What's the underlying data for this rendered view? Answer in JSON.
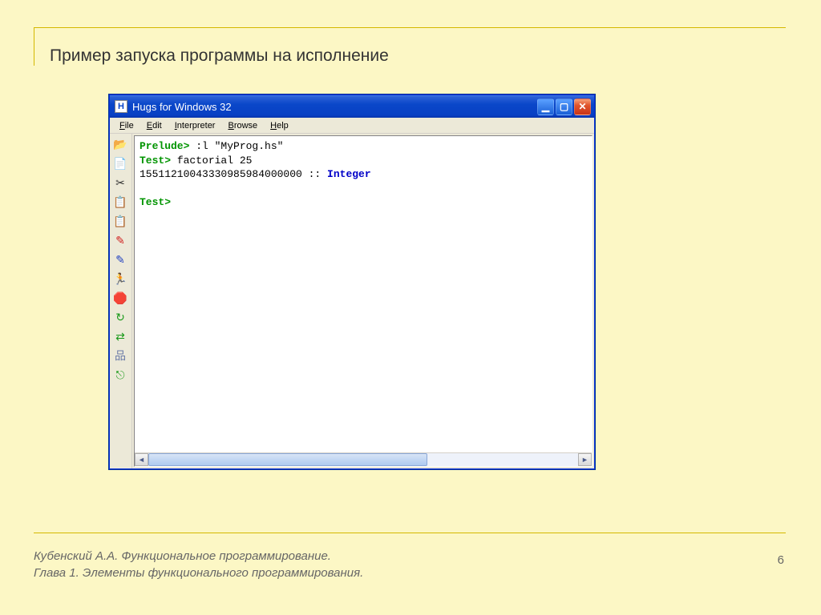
{
  "slide": {
    "title": "Пример запуска программы на исполнение",
    "footer_line1": "Кубенский А.А. Функциональное программирование.",
    "footer_line2": "Глава 1. Элементы функционального программирования.",
    "page": "6"
  },
  "window": {
    "title": "Hugs for Windows 32",
    "app_icon_char": "H",
    "menubar": [
      "File",
      "Edit",
      "Interpreter",
      "Browse",
      "Help"
    ],
    "toolbar_icons": [
      "open-icon",
      "copy-icon",
      "cut-icon",
      "clipboard-icon",
      "paste-icon",
      "pencil-red-icon",
      "pencil-blue-icon",
      "run-icon",
      "stop-icon",
      "reload-icon",
      "tree-icon",
      "settings-icon",
      "exit-icon"
    ],
    "console": {
      "l1_prompt": "Prelude>",
      "l1_cmd": " :l \"MyProg.hs\"",
      "l2_prompt": "Test>",
      "l2_cmd": " factorial 25",
      "l3_result": "15511210043330985984000000 :: ",
      "l3_type": "Integer",
      "l4_prompt": "Test>",
      "l4_cursor": " "
    }
  },
  "icons": {
    "open-icon": "📂",
    "copy-icon": "📄",
    "cut-icon": "✂",
    "clipboard-icon": "📋",
    "paste-icon": "📋",
    "pencil-red-icon": "✎",
    "pencil-blue-icon": "✎",
    "run-icon": "🏃",
    "stop-icon": "🛑",
    "reload-icon": "↻",
    "tree-icon": "⇄",
    "settings-icon": "品",
    "exit-icon": "⎋"
  },
  "icon_colors": {
    "open-icon": "#c9a227",
    "copy-icon": "#888",
    "cut-icon": "#333",
    "clipboard-icon": "#b08030",
    "paste-icon": "#b08030",
    "pencil-red-icon": "#d02020",
    "pencil-blue-icon": "#2040c0",
    "run-icon": "#333",
    "stop-icon": "#d02020",
    "reload-icon": "#1a9a1a",
    "tree-icon": "#1a9a1a",
    "settings-icon": "#6a7aa8",
    "exit-icon": "#1a9a1a"
  }
}
